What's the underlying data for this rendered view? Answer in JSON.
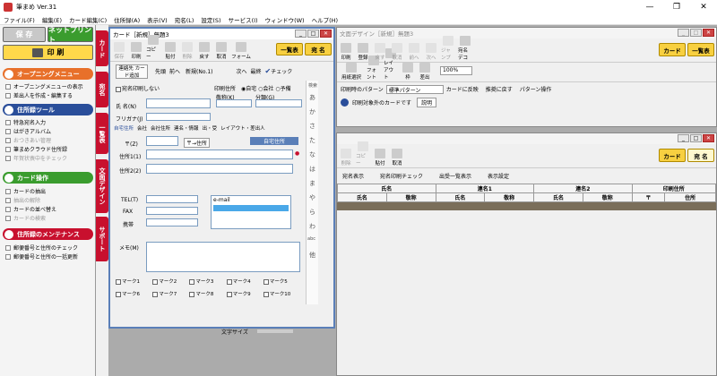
{
  "app": {
    "title": "筆まめ Ver.31",
    "ctrl_min": "—",
    "ctrl_max": "❐",
    "ctrl_close": "✕"
  },
  "menubar": [
    "ファイル(F)",
    "編集(E)",
    "カード編集(C)",
    "住所録(A)",
    "表示(V)",
    "宛名(L)",
    "設定(S)",
    "サービス(I)",
    "ウィンドウ(W)",
    "ヘルプ(H)"
  ],
  "left": {
    "save": "保 存",
    "netprint": "ネットプリント",
    "print": "印 刷",
    "opening": {
      "title": "オープニングメニュー",
      "items": [
        "オープニングメニューの表示",
        "差出人を作成・編集する"
      ]
    },
    "address_tools": {
      "title": "住所録ツール",
      "items": [
        "特急宛名入力",
        "はがきアルバム",
        "おつきあい管理",
        "筆まめクラウド住所録",
        "年賀状喪中をチェック"
      ]
    },
    "card_ops": {
      "title": "カード操作",
      "items": [
        "カードの抽出",
        "抽出の解除",
        "カードの並べ替え",
        "カードの検索"
      ]
    },
    "maintenance": {
      "title": "住所録のメンテナンス",
      "items": [
        "郵便番号と住所のチェック",
        "郵便番号と住所の一括更新"
      ]
    }
  },
  "vtabs": [
    "カード",
    "宛名",
    "一覧表",
    "文面デザイン",
    "サポート"
  ],
  "colors": {
    "red": "#c8102e",
    "green": "#3a9c2e",
    "orange": "#e8702a",
    "blue": "#2a4e9a",
    "yellow": "#f8d040",
    "tan": "#7a6e5a"
  },
  "card_window": {
    "title": "カード［新規］無題3",
    "toolbar": [
      "保存",
      "印刷",
      "コピー",
      "貼付",
      "削除",
      "戻す",
      "取消",
      "フォーム"
    ],
    "ichiran": "一覧表",
    "atena": "宛 名",
    "renraku": "連絡先 カード追加",
    "nav": [
      "先頭",
      "前へ"
    ],
    "record": "新規(No.1)",
    "nav2": [
      "次へ",
      "最終"
    ],
    "check": "チェック",
    "no_print": "宛名印刷しない",
    "print_label": "印刷住所",
    "print_options": [
      "自宅",
      "会社",
      "予備"
    ],
    "name_label": "氏 名(N)",
    "furi_label": "フリガナ(J)",
    "title_label": "敬称(K)",
    "class_label": "分類(G)",
    "tabs": [
      "自宅住所",
      "会社",
      "会社住所",
      "連名・情報",
      "出・受",
      "レイアウト・差出人"
    ],
    "zip_label": "〒(Z)",
    "auto_addr": "〒→住所",
    "addr1": "住所1(1)",
    "addr2": "住所2(2)",
    "home_addr": "自宅住所",
    "tel": "TEL(T)",
    "fax": "FAX",
    "mobile": "携帯",
    "email": "e-mail",
    "memo": "メモ(M)",
    "marks": [
      "マーク1",
      "マーク2",
      "マーク3",
      "マーク4",
      "マーク5",
      "マーク6",
      "マーク7",
      "マーク8",
      "マーク9",
      "マーク10"
    ],
    "font_size": "文字サイズ",
    "kana_index": [
      "検索",
      "あ",
      "か",
      "さ",
      "た",
      "な",
      "は",
      "ま",
      "や",
      "ら",
      "わ",
      "abc",
      "他"
    ]
  },
  "design_window": {
    "title": "文面デザイン［新規］無題3",
    "toolbar": [
      "印刷",
      "登録",
      "戻す",
      "取消",
      "前へ",
      "次へ",
      "ジャンプ",
      "宛名デコ"
    ],
    "card": "カード",
    "ichiran": "一覧表",
    "tools": [
      "用紙選択",
      "フォント",
      "レイアウト",
      "枠",
      "差出"
    ],
    "zoom": "100%",
    "pattern_label": "印刷時のパターン",
    "pattern_value": "標準パターン",
    "reflect": "カードに反映",
    "restore": "推奨に戻す",
    "pattern_op": "パターン操作",
    "info": "印刷対象外のカードです",
    "explain": "説明"
  },
  "list_window": {
    "toolbar": [
      "削除",
      "コピー",
      "貼付",
      "取消"
    ],
    "card": "カード",
    "atena": "宛 名",
    "actions": [
      "宛名表示",
      "宛名印刷チェック",
      "出受一覧表示",
      "表示設定"
    ],
    "group_headers": [
      "氏名",
      "連名1",
      "連名2",
      "印刷住所"
    ],
    "columns": [
      "氏名",
      "敬称",
      "氏名",
      "敬称",
      "氏名",
      "敬称",
      "〒",
      "住所"
    ]
  }
}
